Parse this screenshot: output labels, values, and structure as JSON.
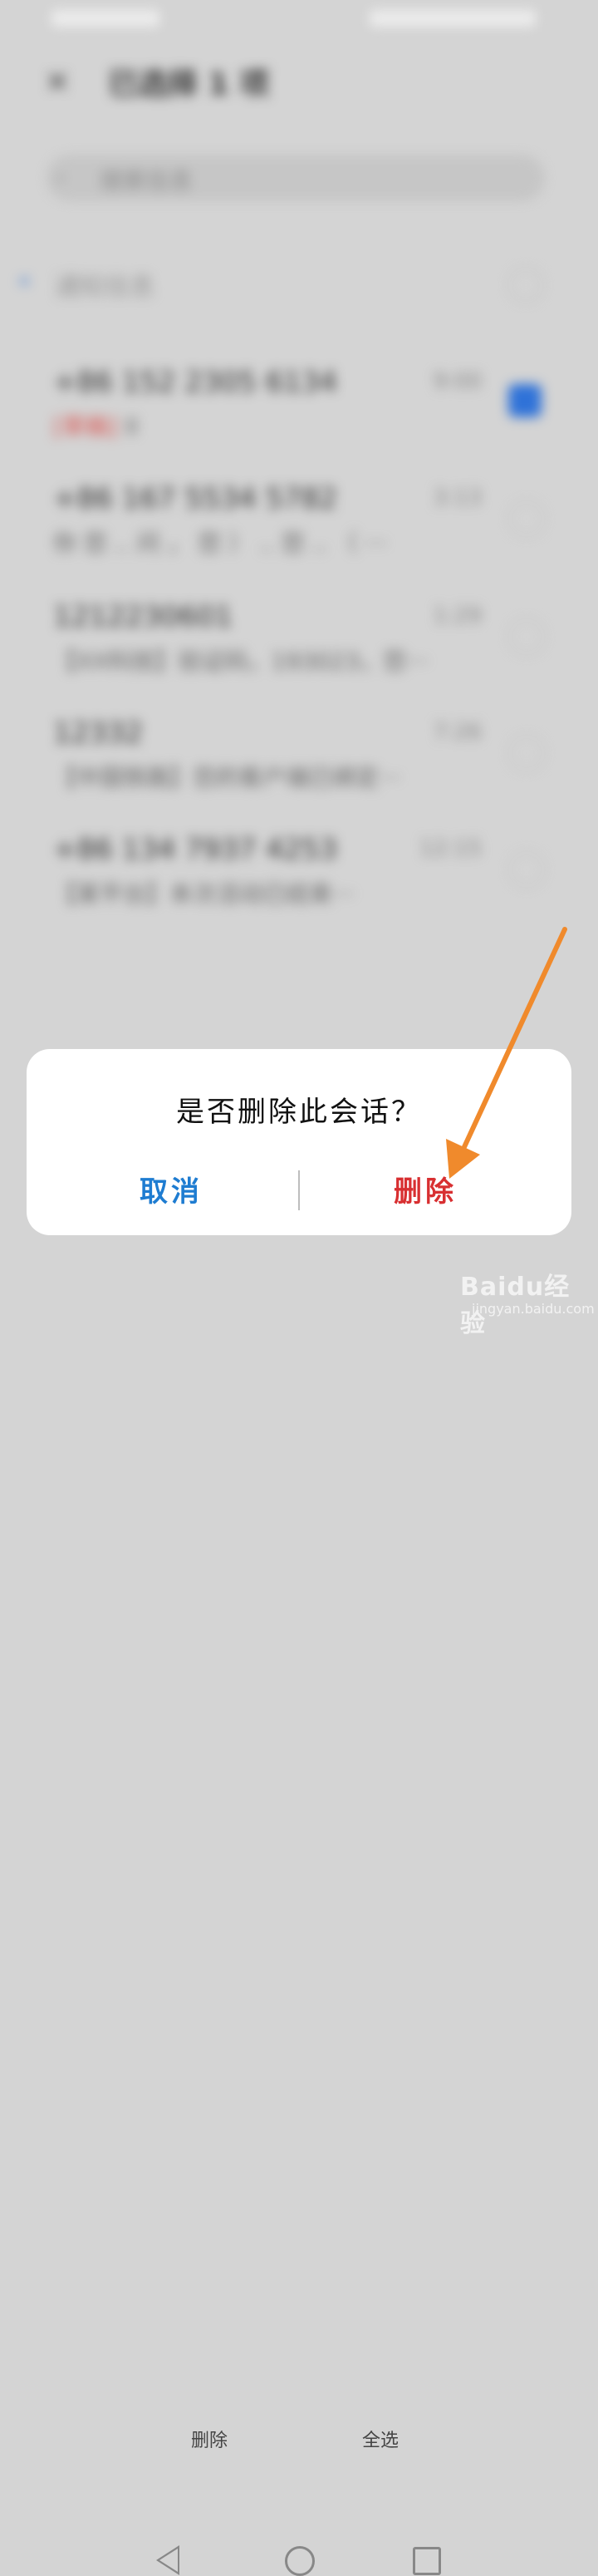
{
  "header": {
    "close_glyph": "✕",
    "title": "已选择 1 项"
  },
  "search": {
    "placeholder": "搜索信息"
  },
  "notice": {
    "label": "通知信息"
  },
  "conversations": [
    {
      "title": "+86 152 2305 6134",
      "time": "9:00",
      "tag": "[草稿]",
      "preview": "ll",
      "checked": true
    },
    {
      "title": "+86 167 5534 5782",
      "time": "3:13",
      "preview": "你  您  ..  问  ，  您  ）  ..  您  ..  （ ···",
      "checked": false
    },
    {
      "title": "1212230601",
      "time": "1:29",
      "preview": "【XX科技】验证码，193023，您···",
      "checked": false
    },
    {
      "title": "12332",
      "time": "7:26",
      "preview": "【中国铁路】您的客户端已绑定···",
      "checked": false
    },
    {
      "title": "+86 134 7937 4253",
      "time": "12:15",
      "preview": "【某平台】本次活动已结束···",
      "checked": false
    }
  ],
  "bottom_bar": {
    "delete_label": "删除",
    "select_all_label": "全选"
  },
  "dialog": {
    "title": "是否删除此会话？",
    "cancel_label": "取消",
    "delete_label": "删除"
  },
  "watermark": {
    "text": "Baidu经验",
    "sub": "jingyan.baidu.com"
  },
  "colors": {
    "accent_blue": "#1e7cd1",
    "danger_red": "#d82f31",
    "arrow_orange": "#f08a2c"
  }
}
